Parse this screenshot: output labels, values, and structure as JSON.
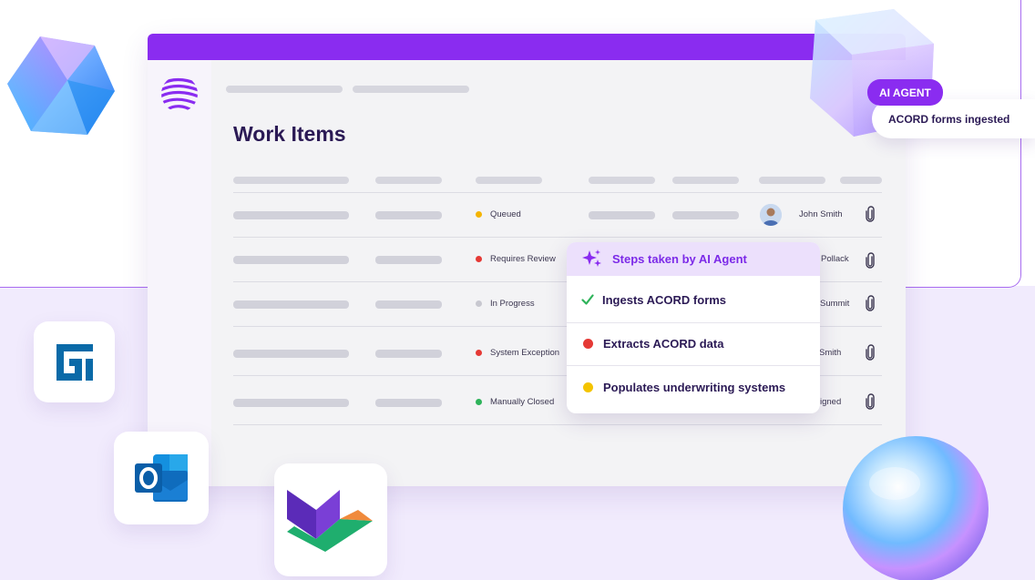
{
  "page": {
    "title": "Work Items"
  },
  "work_items": [
    {
      "status": "Queued",
      "status_color": "#f4b400",
      "assignee": "John Smith",
      "has_avatar": true
    },
    {
      "status": "Requires Review",
      "status_color": "#e53935",
      "assignee": "Pollack",
      "has_avatar": false
    },
    {
      "status": "In Progress",
      "status_color": "#c8c8d0",
      "assignee": "el Summit",
      "has_avatar": false
    },
    {
      "status": "System Exception",
      "status_color": "#e53935",
      "assignee": "Smith",
      "has_avatar": false
    },
    {
      "status": "Manually Closed",
      "status_color": "#2eb35a",
      "assignee": "igned",
      "has_avatar": false
    }
  ],
  "agent_steps": {
    "title": "Steps taken by AI Agent",
    "steps": [
      {
        "label": "Ingests ACORD forms",
        "state": "done",
        "color": "#2eb35a"
      },
      {
        "label": "Extracts ACORD data",
        "state": "error",
        "color": "#e53935"
      },
      {
        "label": "Populates underwriting systems",
        "state": "pending",
        "color": "#f4c400"
      }
    ]
  },
  "ai_agent_badge": {
    "label": "AI AGENT",
    "event": "ACORD forms ingested"
  },
  "colors": {
    "brand_purple": "#8a2cf0",
    "title_navy": "#2b1a55",
    "background_lavender": "#f1ebfd"
  },
  "app_tiles": [
    {
      "name": "guidewire",
      "icon": "guidewire-icon",
      "color": "#0a6aa8"
    },
    {
      "name": "outlook",
      "icon": "outlook-icon",
      "color": "#0f6cbd"
    },
    {
      "name": "partner",
      "icon": "partner-logo-icon",
      "color": "#5b2bb8"
    }
  ]
}
